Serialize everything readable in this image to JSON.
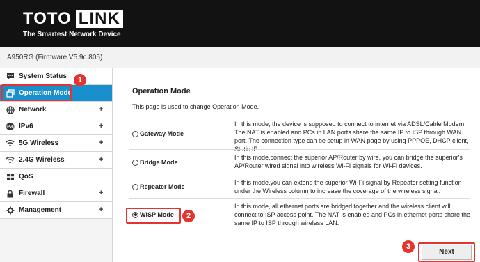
{
  "header": {
    "logo_left": "TOTO",
    "logo_right": "LINK",
    "tagline": "The Smartest Network Device",
    "background": "#121212"
  },
  "firmware": "A950RG (Firmware V5.9c.805)",
  "sidebar": {
    "items": [
      {
        "label": "System Status",
        "icon": "chat-icon",
        "has_plus": false
      },
      {
        "label": "Operation Mode",
        "icon": "copy-icon",
        "has_plus": false,
        "active": true
      },
      {
        "label": "Network",
        "icon": "globe-icon",
        "has_plus": true
      },
      {
        "label": "IPv6",
        "icon": "ipv6-icon",
        "has_plus": true
      },
      {
        "label": "5G Wireless",
        "icon": "wifi-icon",
        "has_plus": true
      },
      {
        "label": "2.4G Wireless",
        "icon": "wifi-icon",
        "has_plus": true
      },
      {
        "label": "QoS",
        "icon": "qos-icon",
        "has_plus": false
      },
      {
        "label": "Firewall",
        "icon": "lock-icon",
        "has_plus": true
      },
      {
        "label": "Management",
        "icon": "gear-icon",
        "has_plus": true
      }
    ],
    "plus": "+"
  },
  "main": {
    "title": "Operation Mode",
    "description": "This page is used to change Operation Mode.",
    "modes": [
      {
        "label": "Gateway Mode",
        "selected": false,
        "desc": "In this mode, the device is supposed to connect to internet via ADSL/Cable Modem. The NAT is enabled and PCs in LAN ports share the same IP to ISP through WAN port. The connection type can be setup in WAN page by using PPPOE, DHCP client, Static IP."
      },
      {
        "label": "Bridge Mode",
        "selected": false,
        "desc": "In this mode,connect the superior AP/Router by wire, you can bridge the superior's AP/Router wired signal into wireless Wi-Fi signals for Wi-Fi devices."
      },
      {
        "label": "Repeater Mode",
        "selected": false,
        "desc": "In this mode,you can extend the superior Wi-Fi signal by Repeater setting function under the Wireless column to increase the coverage of the wireless signal."
      },
      {
        "label": "WISP Mode",
        "selected": true,
        "desc": "In this mode, all ethernet ports are bridged together and the wireless client will connect to ISP access point. The NAT is enabled and PCs in ethernet ports share the same IP to ISP through wireless LAN."
      }
    ],
    "next_label": "Next"
  },
  "markers": [
    "1",
    "2",
    "3"
  ],
  "colors": {
    "accent": "#1a8fcd",
    "annotation": "#e3342f"
  }
}
